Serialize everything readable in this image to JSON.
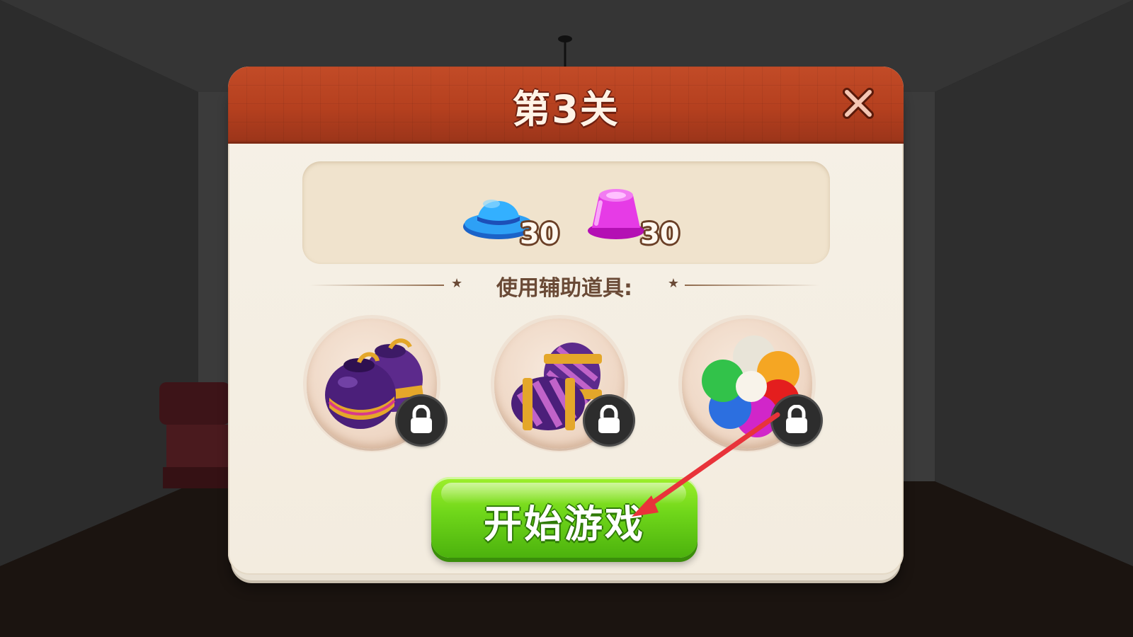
{
  "dialog": {
    "title": "第3关",
    "close_icon": "close-icon"
  },
  "goals": [
    {
      "icon": "blue-hat-icon",
      "count": "30",
      "color": "#1e8df0"
    },
    {
      "icon": "pink-cup-icon",
      "count": "30",
      "color": "#e02de0"
    }
  ],
  "boosters": {
    "label": "使用辅助道具:",
    "items": [
      {
        "icon": "firecracker-bombs-icon",
        "locked": true
      },
      {
        "icon": "striped-candy-icon",
        "locked": true
      },
      {
        "icon": "rainbow-ball-icon",
        "locked": true
      }
    ]
  },
  "start_button": {
    "label": "开始游戏"
  },
  "annotation": {
    "icon": "red-arrow-icon",
    "color": "#e8333a"
  },
  "colors": {
    "header": "#b5401f",
    "paper": "#f5efe4",
    "button_green": "#6fd61a",
    "lock_badge": "#2d2d2d"
  }
}
